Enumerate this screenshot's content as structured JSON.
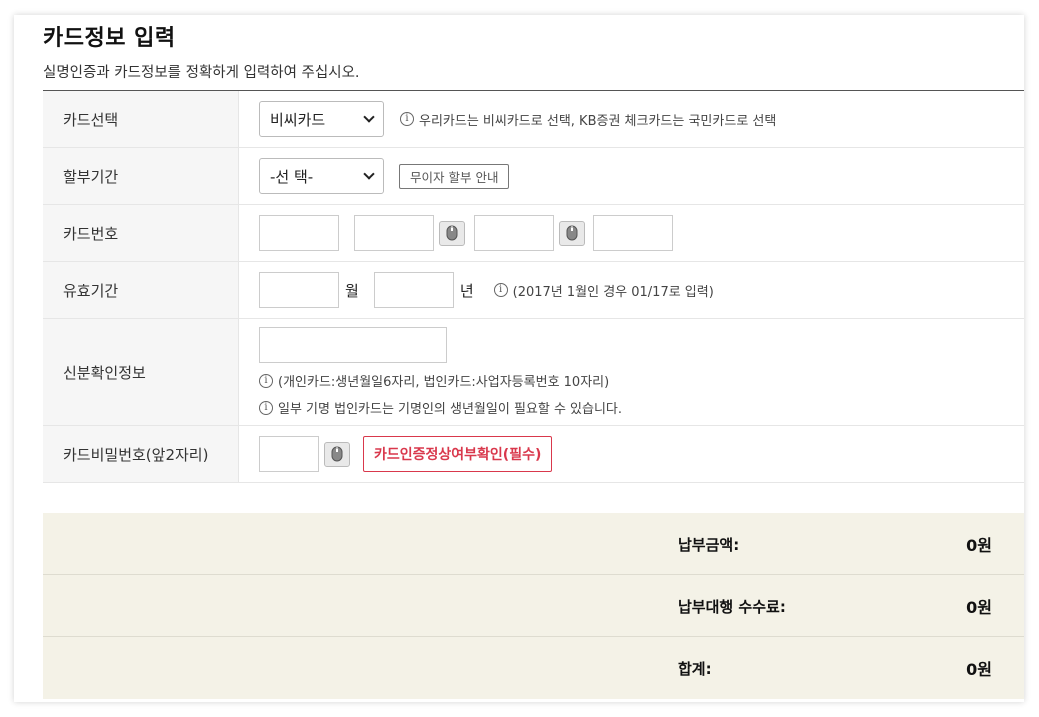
{
  "header": {
    "title": "카드정보 입력",
    "subtitle": "실명인증과 카드정보를 정확하게 입력하여 주십시오."
  },
  "rows": {
    "card_select": {
      "label": "카드선택",
      "value": "비씨카드",
      "info": "우리카드는 비씨카드로 선택, KB증권 체크카드는 국민카드로 선택"
    },
    "installment": {
      "label": "할부기간",
      "value": "-선 택-",
      "button": "무이자 할부 안내"
    },
    "card_number": {
      "label": "카드번호"
    },
    "expiry": {
      "label": "유효기간",
      "month_unit": "월",
      "year_unit": "년",
      "info": "(2017년 1월인 경우 01/17로 입력)"
    },
    "identity": {
      "label": "신분확인정보",
      "info1": "(개인카드:생년월일6자리, 법인카드:사업자등록번호 10자리)",
      "info2": "일부 기명 법인카드는 기명인의 생년월일이 필요할 수 있습니다."
    },
    "password": {
      "label": "카드비밀번호(앞2자리)",
      "verify_button": "카드인증정상여부확인(필수)"
    }
  },
  "summary": {
    "items": [
      {
        "label": "납부금액:",
        "value": "0원"
      },
      {
        "label": "납부대행 수수료:",
        "value": "0원"
      },
      {
        "label": "합계:",
        "value": "0원"
      }
    ]
  },
  "colors": {
    "accent_red": "#d9384c",
    "summary_bg": "#f4f2e7",
    "label_bg": "#f6f6f6"
  },
  "icons": {
    "info": "info-circle-icon",
    "keypad": "mouse-icon"
  }
}
